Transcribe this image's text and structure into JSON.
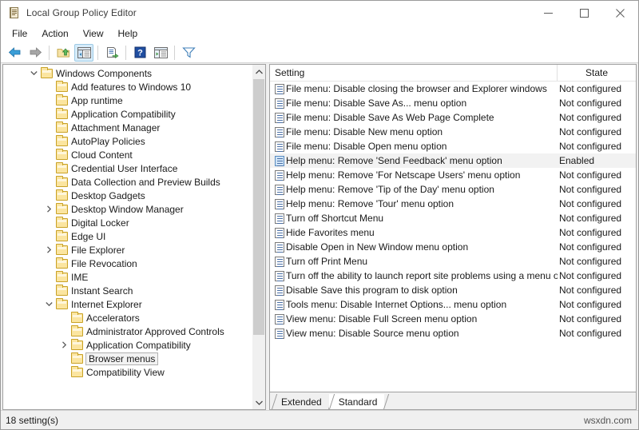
{
  "window": {
    "title": "Local Group Policy Editor",
    "icon": "policy-editor-icon",
    "minimize_label": "—",
    "maximize_label": "☐",
    "close_label": "✕"
  },
  "menubar": {
    "items": [
      {
        "label": "File",
        "name": "menu-file"
      },
      {
        "label": "Action",
        "name": "menu-action"
      },
      {
        "label": "View",
        "name": "menu-view"
      },
      {
        "label": "Help",
        "name": "menu-help"
      }
    ]
  },
  "toolbar": {
    "buttons": [
      {
        "name": "back-button",
        "icon": "arrow-left-icon",
        "active": false
      },
      {
        "name": "forward-button",
        "icon": "arrow-right-icon",
        "active": false
      },
      {
        "name": "up-one-level-button",
        "icon": "folder-up-icon",
        "active": false
      },
      {
        "name": "show-hide-tree-button",
        "icon": "console-tree-icon",
        "active": true
      },
      {
        "name": "export-list-button",
        "icon": "export-list-icon",
        "active": false
      },
      {
        "name": "help-button",
        "icon": "question-mark-icon",
        "active": false
      },
      {
        "name": "show-pane-button",
        "icon": "show-pane-icon",
        "active": false
      },
      {
        "name": "filter-button",
        "icon": "funnel-filter-icon",
        "active": false
      }
    ]
  },
  "tree": {
    "nodes": [
      {
        "label": "Windows Components",
        "indent": 0,
        "twist": "expanded",
        "selected": false
      },
      {
        "label": "Add features to Windows 10",
        "indent": 1,
        "twist": "none",
        "selected": false
      },
      {
        "label": "App runtime",
        "indent": 1,
        "twist": "none",
        "selected": false
      },
      {
        "label": "Application Compatibility",
        "indent": 1,
        "twist": "none",
        "selected": false
      },
      {
        "label": "Attachment Manager",
        "indent": 1,
        "twist": "none",
        "selected": false
      },
      {
        "label": "AutoPlay Policies",
        "indent": 1,
        "twist": "none",
        "selected": false
      },
      {
        "label": "Cloud Content",
        "indent": 1,
        "twist": "none",
        "selected": false
      },
      {
        "label": "Credential User Interface",
        "indent": 1,
        "twist": "none",
        "selected": false
      },
      {
        "label": "Data Collection and Preview Builds",
        "indent": 1,
        "twist": "none",
        "selected": false
      },
      {
        "label": "Desktop Gadgets",
        "indent": 1,
        "twist": "none",
        "selected": false
      },
      {
        "label": "Desktop Window Manager",
        "indent": 1,
        "twist": "collapsed",
        "selected": false
      },
      {
        "label": "Digital Locker",
        "indent": 1,
        "twist": "none",
        "selected": false
      },
      {
        "label": "Edge UI",
        "indent": 1,
        "twist": "none",
        "selected": false
      },
      {
        "label": "File Explorer",
        "indent": 1,
        "twist": "collapsed",
        "selected": false
      },
      {
        "label": "File Revocation",
        "indent": 1,
        "twist": "none",
        "selected": false
      },
      {
        "label": "IME",
        "indent": 1,
        "twist": "none",
        "selected": false
      },
      {
        "label": "Instant Search",
        "indent": 1,
        "twist": "none",
        "selected": false
      },
      {
        "label": "Internet Explorer",
        "indent": 1,
        "twist": "expanded",
        "selected": false
      },
      {
        "label": "Accelerators",
        "indent": 2,
        "twist": "none",
        "selected": false
      },
      {
        "label": "Administrator Approved Controls",
        "indent": 2,
        "twist": "none",
        "selected": false
      },
      {
        "label": "Application Compatibility",
        "indent": 2,
        "twist": "collapsed",
        "selected": false
      },
      {
        "label": "Browser menus",
        "indent": 2,
        "twist": "none",
        "selected": true
      },
      {
        "label": "Compatibility View",
        "indent": 2,
        "twist": "none",
        "selected": false
      }
    ]
  },
  "list": {
    "columns": [
      {
        "label": "Setting",
        "name": "column-setting"
      },
      {
        "label": "State",
        "name": "column-state"
      }
    ],
    "rows": [
      {
        "setting": "File menu: Disable closing the browser and Explorer windows",
        "state": "Not configured",
        "selected": false
      },
      {
        "setting": "File menu: Disable Save As... menu option",
        "state": "Not configured",
        "selected": false
      },
      {
        "setting": "File menu: Disable Save As Web Page Complete",
        "state": "Not configured",
        "selected": false
      },
      {
        "setting": "File menu: Disable New menu option",
        "state": "Not configured",
        "selected": false
      },
      {
        "setting": "File menu: Disable Open menu option",
        "state": "Not configured",
        "selected": false
      },
      {
        "setting": "Help menu: Remove 'Send Feedback' menu option",
        "state": "Enabled",
        "selected": true
      },
      {
        "setting": "Help menu: Remove 'For Netscape Users' menu option",
        "state": "Not configured",
        "selected": false
      },
      {
        "setting": "Help menu: Remove 'Tip of the Day' menu option",
        "state": "Not configured",
        "selected": false
      },
      {
        "setting": "Help menu: Remove 'Tour' menu option",
        "state": "Not configured",
        "selected": false
      },
      {
        "setting": "Turn off Shortcut Menu",
        "state": "Not configured",
        "selected": false
      },
      {
        "setting": "Hide Favorites menu",
        "state": "Not configured",
        "selected": false
      },
      {
        "setting": "Disable Open in New Window menu option",
        "state": "Not configured",
        "selected": false
      },
      {
        "setting": "Turn off Print Menu",
        "state": "Not configured",
        "selected": false
      },
      {
        "setting": "Turn off the ability to launch report site problems using a menu option",
        "state": "Not configured",
        "selected": false
      },
      {
        "setting": "Disable Save this program to disk option",
        "state": "Not configured",
        "selected": false
      },
      {
        "setting": "Tools menu: Disable Internet Options... menu option",
        "state": "Not configured",
        "selected": false
      },
      {
        "setting": "View menu: Disable Full Screen menu option",
        "state": "Not configured",
        "selected": false
      },
      {
        "setting": "View menu: Disable Source menu option",
        "state": "Not configured",
        "selected": false
      }
    ]
  },
  "tabs": [
    {
      "label": "Extended",
      "active": false,
      "name": "tab-extended"
    },
    {
      "label": "Standard",
      "active": true,
      "name": "tab-standard"
    }
  ],
  "statusbar": {
    "text": "18 setting(s)",
    "watermark": "wsxdn.com"
  },
  "colors": {
    "selection": "#f2f2f2",
    "folder": "#fbe5a0",
    "toolbar_active": "#d6ecfb"
  }
}
